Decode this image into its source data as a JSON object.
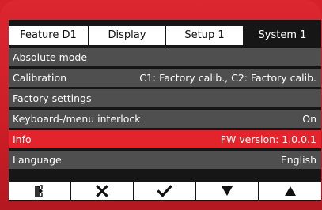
{
  "tabs": [
    {
      "label": "Feature  D1",
      "active": false
    },
    {
      "label": "Display",
      "active": false
    },
    {
      "label": "Setup 1",
      "active": false
    },
    {
      "label": "System 1",
      "active": true
    }
  ],
  "menu": [
    {
      "label": "Absolute mode",
      "value": "",
      "selected": false
    },
    {
      "label": "Calibration",
      "value": "C1: Factory calib., C2: Factory calib.",
      "selected": false
    },
    {
      "label": "Factory settings",
      "value": "",
      "selected": false
    },
    {
      "label": "Keyboard-/menu interlock",
      "value": "On",
      "selected": false
    },
    {
      "label": "Info",
      "value": "FW version: 1.0.0.1",
      "selected": true
    },
    {
      "label": "Language",
      "value": "English",
      "selected": false
    }
  ],
  "softkeys": [
    {
      "icon": "exit-icon"
    },
    {
      "icon": "cancel-x-icon"
    },
    {
      "icon": "confirm-check-icon"
    },
    {
      "icon": "arrow-down-icon"
    },
    {
      "icon": "arrow-up-icon"
    }
  ],
  "colors": {
    "bezel": "#d6202a",
    "screen": "#161616",
    "row": "#4f4f4f",
    "selected_row": "#e3242d",
    "tab": "#ffffff"
  }
}
